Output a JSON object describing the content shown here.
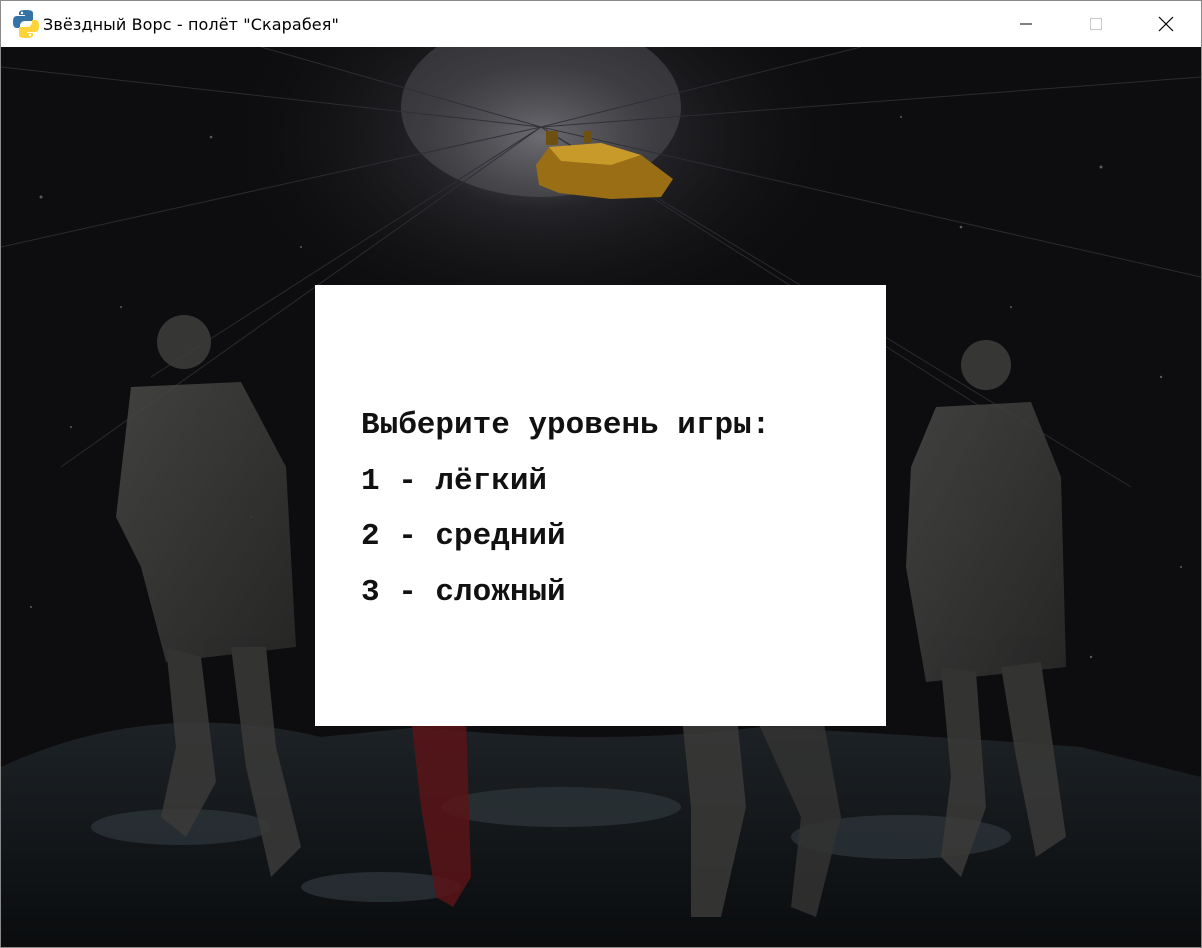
{
  "window": {
    "title": "Звёздный Ворс - полёт \"Скарабея\"",
    "icon": "python-snake-icon",
    "controls": [
      "minimize-icon",
      "maximize-icon",
      "close-icon"
    ]
  },
  "menu": {
    "heading": "Выберите уровень игры:",
    "options": [
      {
        "label": "1 - лёгкий"
      },
      {
        "label": "2 - средний"
      },
      {
        "label": "3 - сложный"
      }
    ]
  },
  "colors": {
    "menu_background": "#ffffff",
    "menu_text": "#111111",
    "scene_background": "#0c0c0e",
    "spaceship": "#b88a1e"
  }
}
